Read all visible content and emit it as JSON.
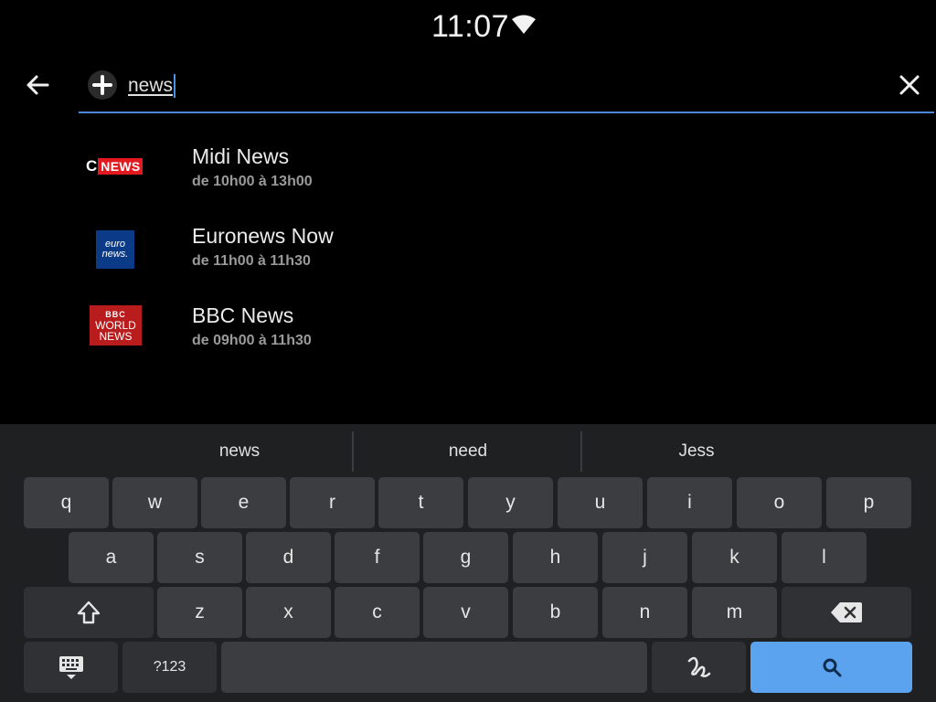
{
  "status_bar": {
    "time": "11:07"
  },
  "search": {
    "query": "news"
  },
  "results": [
    {
      "title": "Midi News",
      "time": "de 10h00 à 13h00",
      "logo_text": "NEWS",
      "logo_prefix": "C"
    },
    {
      "title": "Euronews Now",
      "time": "de 11h00 à 11h30",
      "logo_line1": "euro",
      "logo_line2": "news."
    },
    {
      "title": "BBC News",
      "time": "de 09h00 à 11h30",
      "logo_line1": "BBC",
      "logo_line2": "WORLD",
      "logo_line3": "NEWS"
    }
  ],
  "keyboard": {
    "suggestions": [
      "news",
      "need",
      "Jess"
    ],
    "row1": [
      "q",
      "w",
      "e",
      "r",
      "t",
      "y",
      "u",
      "i",
      "o",
      "p"
    ],
    "row2": [
      "a",
      "s",
      "d",
      "f",
      "g",
      "h",
      "j",
      "k",
      "l"
    ],
    "row3": [
      "z",
      "x",
      "c",
      "v",
      "b",
      "n",
      "m"
    ],
    "symbols_label": "?123"
  },
  "colors": {
    "accent": "#4d88d8",
    "search_key": "#5ba3ee",
    "key_bg": "#3b3d40",
    "keyboard_bg": "#1e2022"
  },
  "icons": [
    "wifi-icon",
    "back-arrow-icon",
    "add-icon",
    "close-icon",
    "shift-icon",
    "backspace-icon",
    "keyboard-icon",
    "handwriting-icon",
    "search-icon"
  ]
}
